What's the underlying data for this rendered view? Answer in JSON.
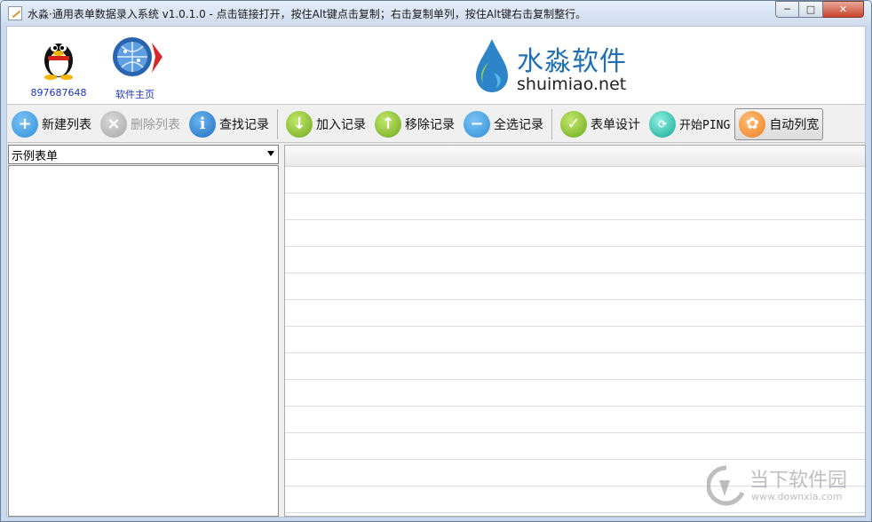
{
  "window": {
    "title": "水淼·通用表单数据录入系统 v1.0.1.0 - 点击链接打开，按住Alt键点击复制；右击复制单列，按住Alt键右击复制整行。",
    "min_glyph": "─",
    "max_glyph": "□",
    "close_glyph": "✕"
  },
  "header": {
    "qq_label": "897687648",
    "home_label": "软件主页",
    "logo_cn": "水淼软件",
    "logo_en": "shuimiao.net"
  },
  "toolbar": {
    "items": [
      {
        "label": "新建列表",
        "icon": "plus-icon",
        "color": "#2f8fd8",
        "enabled": true
      },
      {
        "label": "删除列表",
        "icon": "close-circle-icon",
        "color": "#b3b3b3",
        "enabled": false
      },
      {
        "label": "查找记录",
        "icon": "info-icon",
        "color": "#2b7fd0",
        "enabled": true
      },
      {
        "label": "加入记录",
        "icon": "arrow-down-icon",
        "color": "#7fb52a",
        "enabled": true
      },
      {
        "label": "移除记录",
        "icon": "arrow-up-icon",
        "color": "#7fb52a",
        "enabled": true
      },
      {
        "label": "全选记录",
        "icon": "minus-icon",
        "color": "#2f8fd8",
        "enabled": true
      },
      {
        "label": "表单设计",
        "icon": "check-icon",
        "color": "#7fb52a",
        "enabled": true
      },
      {
        "label": "开始PING",
        "icon": "ping-icon",
        "color": "#1fb6a4",
        "enabled": true
      },
      {
        "label": "自动列宽",
        "icon": "reel-icon",
        "color": "#f28a2e",
        "enabled": true
      }
    ]
  },
  "left_pane": {
    "selected_form": "示例表单"
  },
  "watermark": {
    "cn": "当下软件园",
    "en": "www.downxia.com"
  }
}
